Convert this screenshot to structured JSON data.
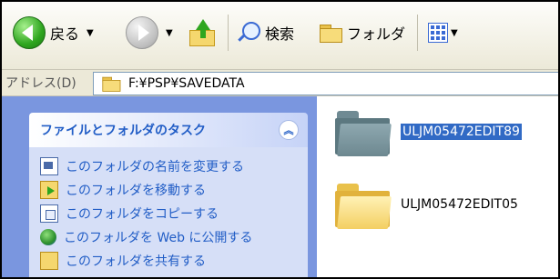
{
  "toolbar": {
    "back_label": "戻る",
    "search_label": "検索",
    "folders_label": "フォルダ"
  },
  "address": {
    "label": "アドレス(D)",
    "path": "F:¥PSP¥SAVEDATA"
  },
  "task_pane": {
    "title": "ファイルとフォルダのタスク",
    "items": [
      {
        "label": "このフォルダの名前を変更する",
        "icon": "rename-icon"
      },
      {
        "label": "このフォルダを移動する",
        "icon": "move-icon"
      },
      {
        "label": "このフォルダをコピーする",
        "icon": "copy-icon"
      },
      {
        "label": "このフォルダを Web に公開する",
        "icon": "web-publish-icon"
      },
      {
        "label": "このフォルダを共有する",
        "icon": "share-icon"
      }
    ]
  },
  "files": [
    {
      "name": "ULJM05472EDIT89",
      "selected": true
    },
    {
      "name": "ULJM05472EDIT05",
      "selected": false
    }
  ],
  "colors": {
    "task_pane_bg": "#7a96df",
    "task_title": "#215dc6",
    "selection": "#316ac5"
  }
}
